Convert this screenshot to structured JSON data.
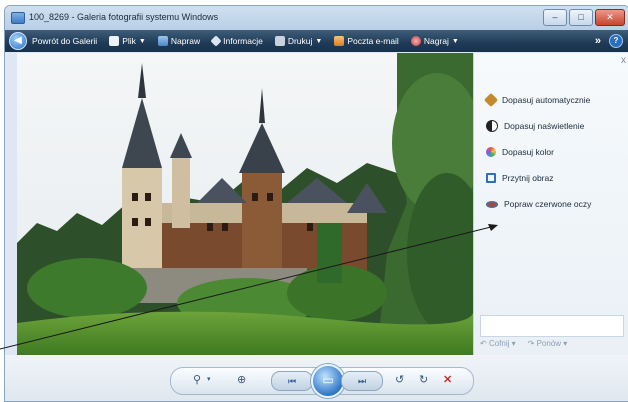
{
  "window": {
    "title": "100_8269 - Galeria fotografii systemu Windows"
  },
  "window_buttons": {
    "minimize": "–",
    "maximize": "□",
    "close": "✕"
  },
  "toolbar": {
    "back_label": "Powrót do Galerii",
    "file_label": "Plik",
    "fix_label": "Napraw",
    "info_label": "Informacje",
    "print_label": "Drukuj",
    "email_label": "Poczta e-mail",
    "burn_label": "Nagraj",
    "more_label": "»",
    "help_label": "?"
  },
  "fix_panel": {
    "close_label": "x",
    "items": [
      {
        "label": "Dopasuj automatycznie",
        "icon": "magic-wand-icon",
        "color": "#c48a2a"
      },
      {
        "label": "Dopasuj naświetlenie",
        "icon": "contrast-icon",
        "color": "#222222"
      },
      {
        "label": "Dopasuj kolor",
        "icon": "color-wheel-icon",
        "color": "#e0613a"
      },
      {
        "label": "Przytnij obraz",
        "icon": "crop-icon",
        "color": "#2d6fb8"
      },
      {
        "label": "Popraw czerwone oczy",
        "icon": "red-eye-icon",
        "color": "#5a6a7a"
      }
    ],
    "undo_label": "Cofnij",
    "redo_label": "Ponów"
  },
  "bottom_controls": {
    "zoom": "⚲",
    "zoom_caret": "▾",
    "actual_size": "⊕",
    "previous": "⏮",
    "slideshow": "▭",
    "next": "⏭",
    "rotate_ccw": "↺",
    "rotate_cw": "↻",
    "delete": "✕"
  }
}
